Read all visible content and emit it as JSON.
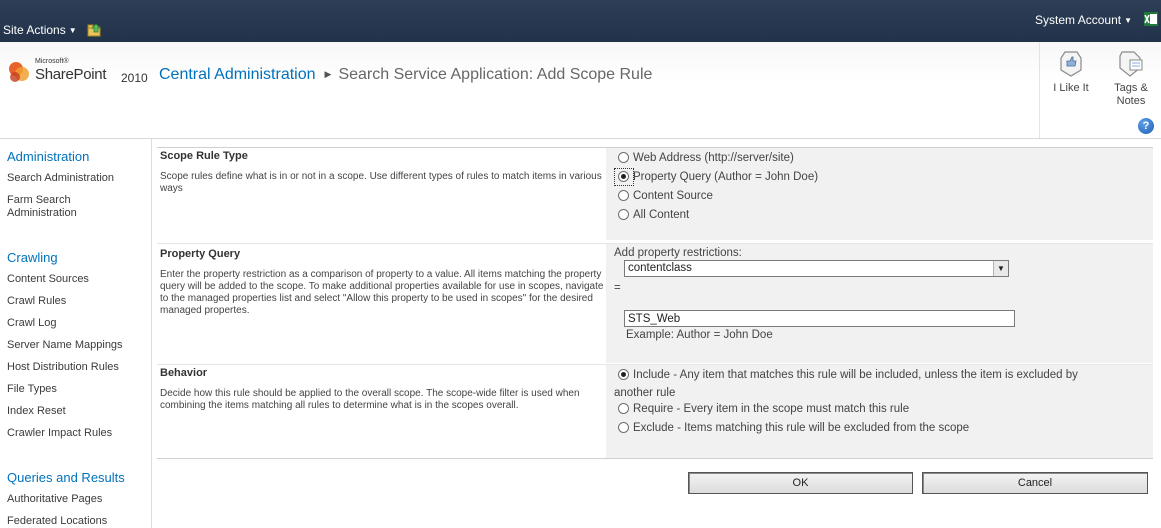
{
  "topbar": {
    "site_actions": "Site Actions",
    "system_account": "System Account"
  },
  "logo": {
    "ms": "Microsoft®",
    "product": "SharePoint",
    "year": "2010"
  },
  "breadcrumb": {
    "root": "Central Administration",
    "current": "Search Service Application: Add Scope Rule"
  },
  "social": {
    "like": "I Like It",
    "tags_line1": "Tags &",
    "tags_line2": "Notes"
  },
  "help": "?",
  "leftnav": {
    "groups": [
      {
        "heading": "Administration",
        "items": [
          "Search Administration",
          "Farm Search Administration"
        ]
      },
      {
        "heading": "Crawling",
        "items": [
          "Content Sources",
          "Crawl Rules",
          "Crawl Log",
          "Server Name Mappings",
          "Host Distribution Rules",
          "File Types",
          "Index Reset",
          "Crawler Impact Rules"
        ]
      },
      {
        "heading": "Queries and Results",
        "items": [
          "Authoritative Pages",
          "Federated Locations"
        ]
      }
    ]
  },
  "form": {
    "scope_rule_type": {
      "title": "Scope Rule Type",
      "description": "Scope rules define what is in or not in a scope. Use different types of rules to match items in various ways",
      "options": [
        "Web Address (http://server/site)",
        "Property Query (Author = John Doe)",
        "Content Source",
        "All Content"
      ],
      "selected": "Property Query (Author = John Doe)"
    },
    "property_query": {
      "title": "Property Query",
      "description": "Enter the property restriction as a comparison of property to a value. All items matching the property query will be added to the scope. To make additional properties available for use in scopes, navigate to the managed properties list and select \"Allow this property to be used in scopes\" for the desired managed propertes.",
      "add_label": "Add property restrictions:",
      "property_value": "contentclass",
      "equals": "=",
      "value": "STS_Web",
      "example": "Example: Author = John Doe"
    },
    "behavior": {
      "title": "Behavior",
      "description": "Decide how this rule should be applied to the overall scope. The scope-wide filter is used when combining the items matching all rules to determine what is in the scopes overall.",
      "options": [
        "Include - Any item that matches this rule will be included, unless the item is excluded by",
        "Require - Every item in the scope must match this rule",
        "Exclude - Items matching this rule will be excluded from the scope"
      ],
      "include_continuation": "another rule",
      "selected": "Include"
    },
    "ok_label": "OK",
    "cancel_label": "Cancel"
  }
}
